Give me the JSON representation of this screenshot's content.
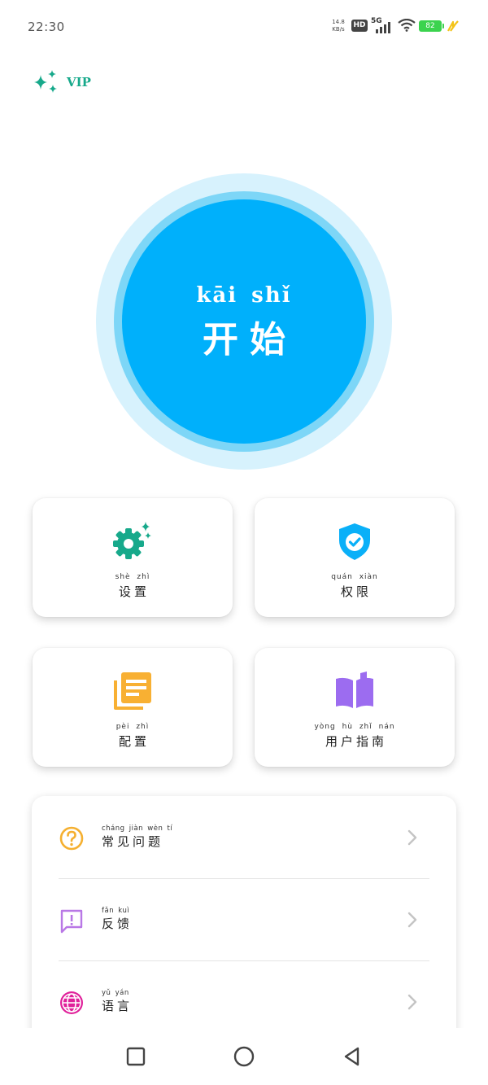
{
  "status_bar": {
    "time": "22:30",
    "net_speed_value": "14.8",
    "net_speed_unit": "KB/s",
    "hd_label": "HD",
    "network_label": "5G",
    "battery_level": "82",
    "icons": [
      "hd-icon",
      "signal-icon",
      "wifi-icon",
      "battery-icon",
      "charging-icon"
    ]
  },
  "vip": {
    "label": "VIP",
    "icon": "sparkle-icon",
    "color": "#17a98b"
  },
  "start": {
    "pinyin": "kāi shǐ",
    "label": "开始",
    "color": "#00b0fb"
  },
  "cards": [
    {
      "pinyin": "shè zhì",
      "label": "设置",
      "icon": "gear-sparkle-icon",
      "color": "#17a98b"
    },
    {
      "pinyin": "quán xiàn",
      "label": "权限",
      "icon": "shield-check-icon",
      "color": "#0ab0f8"
    },
    {
      "pinyin": "pèi zhì",
      "label": "配置",
      "icon": "documents-icon",
      "color": "#f8b033"
    },
    {
      "pinyin": "yòng hù zhǐ nán",
      "label": "用户指南",
      "icon": "book-icon",
      "color": "#9c6cf0"
    }
  ],
  "list": [
    {
      "pinyin": "cháng jiàn wèn tí",
      "label": "常见问题",
      "icon": "question-circle-icon",
      "color": "#f5b031"
    },
    {
      "pinyin": "fǎn kuì",
      "label": "反馈",
      "icon": "feedback-icon",
      "color": "#b978e6"
    },
    {
      "pinyin": "yǔ yán",
      "label": "语言",
      "icon": "globe-icon",
      "color": "#e0209a"
    }
  ],
  "nav": {
    "icons": [
      "recent-apps-icon",
      "home-icon",
      "back-icon"
    ]
  }
}
